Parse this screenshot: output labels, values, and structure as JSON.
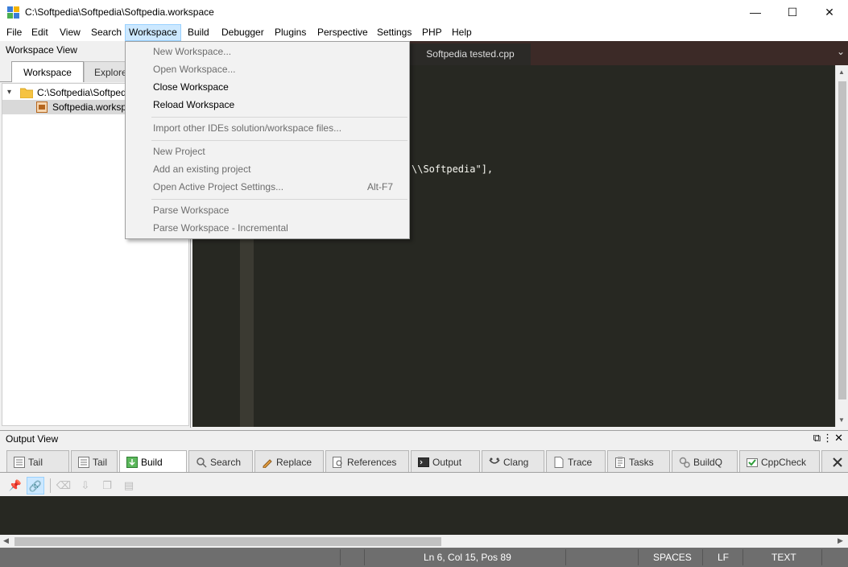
{
  "window": {
    "title": "C:\\Softpedia\\Softpedia\\Softpedia.workspace",
    "minimize_glyph": "—",
    "maximize_glyph": "☐",
    "close_glyph": "✕"
  },
  "menubar": {
    "items": [
      "File",
      "Edit",
      "View",
      "Search",
      "Workspace",
      "Build",
      "Debugger",
      "Plugins",
      "Perspective",
      "Settings",
      "PHP",
      "Help"
    ],
    "active": "Workspace"
  },
  "workspace_view": {
    "header": "Workspace View",
    "tabs": [
      "Workspace",
      "Explorer"
    ],
    "tree": [
      {
        "label": "C:\\Softpedia\\Softpedia",
        "icon": "folder-icon"
      },
      {
        "label": "Softpedia.workspace",
        "icon": "workspace-file-icon"
      }
    ]
  },
  "editor": {
    "tab": "Softpedia tested.cpp",
    "visible_code": [
      "\\\\Softpedia\"],"
    ]
  },
  "workspace_menu": {
    "items": [
      {
        "label": "New Workspace...",
        "enabled": false
      },
      {
        "label": "Open Workspace...",
        "enabled": false
      },
      {
        "label": "Close Workspace",
        "enabled": true
      },
      {
        "label": "Reload Workspace",
        "enabled": true
      },
      {
        "label": "Import other IDEs solution/workspace files...",
        "enabled": false
      },
      {
        "label": "New Project",
        "enabled": false
      },
      {
        "label": "Add an existing project",
        "enabled": false
      },
      {
        "label": "Open Active Project Settings...",
        "enabled": false,
        "shortcut": "Alt-F7"
      },
      {
        "label": "Parse Workspace",
        "enabled": false
      },
      {
        "label": "Parse Workspace - Incremental",
        "enabled": false
      }
    ]
  },
  "output_view": {
    "header": "Output View",
    "tabs": [
      {
        "label": "Tail",
        "icon": "tail-icon"
      },
      {
        "label": "Tail",
        "icon": "tail-icon"
      },
      {
        "label": "Build",
        "icon": "build-icon",
        "active": true
      },
      {
        "label": "Search",
        "icon": "search-icon"
      },
      {
        "label": "Replace",
        "icon": "replace-icon"
      },
      {
        "label": "References",
        "icon": "references-icon"
      },
      {
        "label": "Output",
        "icon": "output-icon"
      },
      {
        "label": "Clang",
        "icon": "clang-icon"
      },
      {
        "label": "Trace",
        "icon": "trace-icon"
      },
      {
        "label": "Tasks",
        "icon": "tasks-icon"
      },
      {
        "label": "BuildQ",
        "icon": "buildq-icon"
      },
      {
        "label": "CppCheck",
        "icon": "cppcheck-icon"
      }
    ]
  },
  "statusbar": {
    "position": "Ln 6, Col 15, Pos 89",
    "indent": "SPACES",
    "eol": "LF",
    "mode": "TEXT"
  },
  "colors": {
    "editor_bg": "#272822",
    "editor_tab_bar": "#3c2a27",
    "menu_highlight": "#cce8ff",
    "statusbar_bg": "#6e6e6e"
  }
}
